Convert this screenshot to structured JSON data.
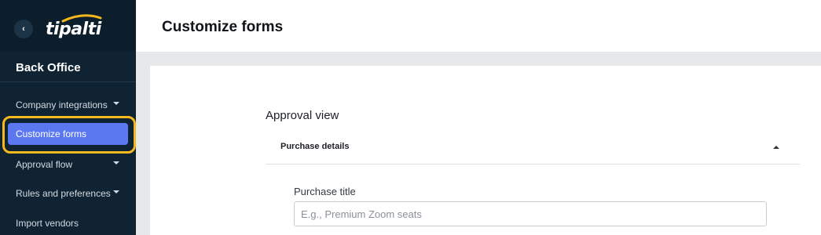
{
  "sidebar": {
    "logo_text": "tipalti",
    "back_icon": "chevron-left-icon",
    "section_title": "Back Office",
    "items": [
      {
        "label": "Company integrations",
        "has_caret": true,
        "active": false
      },
      {
        "label": "Customize forms",
        "has_caret": false,
        "active": true
      },
      {
        "label": "Approval flow",
        "has_caret": true,
        "active": false
      },
      {
        "label": "Rules and preferences",
        "has_caret": true,
        "active": false
      },
      {
        "label": "Import vendors",
        "has_caret": false,
        "active": false
      }
    ]
  },
  "header": {
    "title": "Customize forms"
  },
  "main": {
    "view_title": "Approval view",
    "accordion": {
      "title": "Purchase details",
      "expanded": true
    },
    "fields": [
      {
        "label": "Purchase title",
        "value": "",
        "placeholder": "E.g., Premium Zoom seats"
      }
    ]
  },
  "colors": {
    "sidebar_bg": "#0f2332",
    "active_item": "#5b78f1",
    "highlight_ring": "#f6b81e"
  }
}
